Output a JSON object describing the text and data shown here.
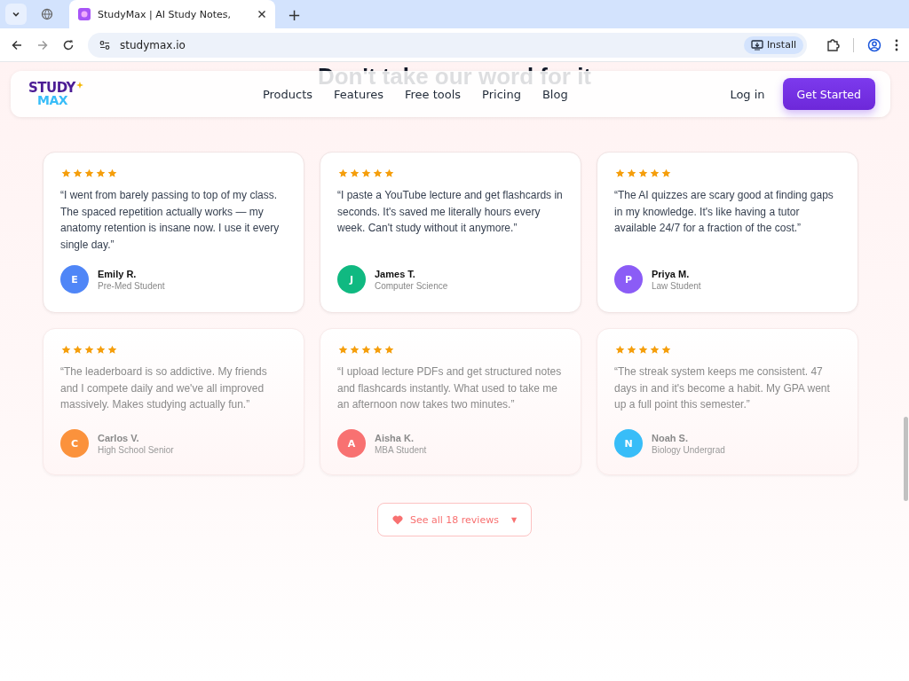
{
  "browser": {
    "tabs": [
      {
        "title": "StudyMax | AI Study Notes,",
        "selected": true
      }
    ],
    "new_tab": "+",
    "url": "studymax.io",
    "install": "Install"
  },
  "section": {
    "heading": "Don't take our word for it"
  },
  "nav": {
    "logo": [
      "STUDY",
      "MAX"
    ],
    "links": [
      "Products",
      "Features",
      "Free tools",
      "Pricing",
      "Blog"
    ],
    "login": "Log in",
    "cta": "Get Started"
  },
  "reviews": [
    {
      "stars": 5,
      "quote": "“I went from barely passing to top of my class. The spaced repetition actually works — my anatomy retention is insane now. I use it every single day.”",
      "initial": "E",
      "name": "Emily R.",
      "role": "Pre-Med Student",
      "color": "#4f86f7"
    },
    {
      "stars": 5,
      "quote": "“I paste a YouTube lecture and get flashcards in seconds. It's saved me literally hours every week. Can't study without it anymore.”",
      "initial": "J",
      "name": "James T.",
      "role": "Computer Science",
      "color": "#10b981"
    },
    {
      "stars": 5,
      "quote": "“The AI quizzes are scary good at finding gaps in my knowledge. It's like having a tutor available 24/7 for a fraction of the cost.”",
      "initial": "P",
      "name": "Priya M.",
      "role": "Law Student",
      "color": "#8b5cf6"
    },
    {
      "stars": 5,
      "quote": "“The leaderboard is so addictive. My friends and I compete daily and we've all improved massively. Makes studying actually fun.”",
      "initial": "C",
      "name": "Carlos V.",
      "role": "High School Senior",
      "color": "#fb923c"
    },
    {
      "stars": 5,
      "quote": "“I upload lecture PDFs and get structured notes and flashcards instantly. What used to take me an afternoon now takes two minutes.”",
      "initial": "A",
      "name": "Aisha K.",
      "role": "MBA Student",
      "color": "#f87171"
    },
    {
      "stars": 5,
      "quote": "“The streak system keeps me consistent. 47 days in and it's become a habit. My GPA went up a full point this semester.”",
      "initial": "N",
      "name": "Noah S.",
      "role": "Biology Undergrad",
      "color": "#38bdf8"
    }
  ],
  "see_all": {
    "label": "See all 18 reviews",
    "caret": "▼"
  }
}
